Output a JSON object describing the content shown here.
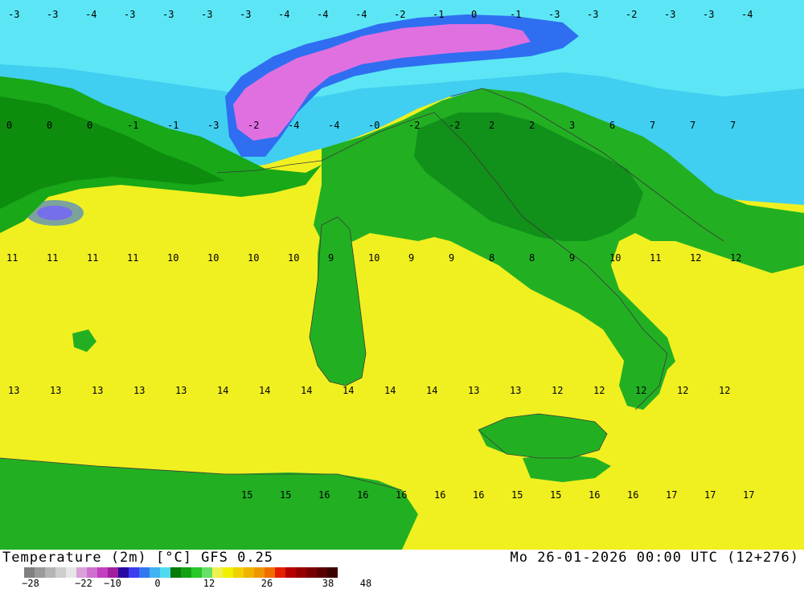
{
  "map": {
    "title": "Temperature (2m) [°C] GFS 0.25",
    "timestamp": "Mo 26-01-2026 00:00 UTC (12+276)",
    "region": "Italy / Central Mediterranean",
    "units": "°C",
    "colors": {
      "land_green": "#22b022",
      "land_dark_green": "#118811",
      "sea_yellow": "#f0f020",
      "cold_cyan": "#40d0f0",
      "cold_blue": "#3070f0",
      "mountain_magenta": "#e070e0",
      "coast_line": "#3a3a3a"
    },
    "sample_values": {
      "north_alps": [
        "-3",
        "-3",
        "-4",
        "-3",
        "-3",
        "-3",
        "-3",
        "-4",
        "-4",
        "-4",
        "-2",
        "-1",
        "0",
        "-1",
        "-3",
        "-3",
        "-2",
        "-3",
        "-3",
        "-4"
      ],
      "po_valley": [
        "0",
        "0",
        "0",
        "-1",
        "-1",
        "-3",
        "-2",
        "-4",
        "-4",
        "-0",
        "-2",
        "-2",
        "2",
        "2",
        "3",
        "6",
        "7",
        "7",
        "7"
      ],
      "tyrrhenian": [
        "11",
        "11",
        "11",
        "11",
        "10",
        "10",
        "10",
        "10",
        "9",
        "10",
        "9",
        "9",
        "8",
        "8",
        "9",
        "10",
        "11",
        "12",
        "12"
      ],
      "south_sea": [
        "13",
        "13",
        "13",
        "13",
        "13",
        "14",
        "14",
        "14",
        "14",
        "14",
        "14",
        "13",
        "13",
        "12",
        "12",
        "12",
        "12",
        "12"
      ],
      "ionian": [
        "15",
        "15",
        "16",
        "16",
        "16",
        "16",
        "16",
        "15",
        "15",
        "16",
        "16",
        "17",
        "17",
        "17"
      ]
    }
  },
  "legend": {
    "colors": [
      "#808080",
      "#9a9a9a",
      "#b4b4b4",
      "#cdcdcd",
      "#e6e6e6",
      "#d9a0d9",
      "#cf70cf",
      "#c040c0",
      "#a020a0",
      "#280aa0",
      "#3c3cf0",
      "#3278f0",
      "#40b4f0",
      "#50dcf0",
      "#0a7a0a",
      "#14a014",
      "#28c828",
      "#66e066",
      "#f0f050",
      "#f0f000",
      "#f0d200",
      "#f0b400",
      "#f09600",
      "#f06e00",
      "#e61e00",
      "#b40000",
      "#960000",
      "#780000",
      "#5a0000",
      "#3c0000"
    ],
    "ticks": [
      "−28",
      "−22",
      "−10",
      "0",
      "12",
      "26",
      "38",
      "48"
    ]
  }
}
